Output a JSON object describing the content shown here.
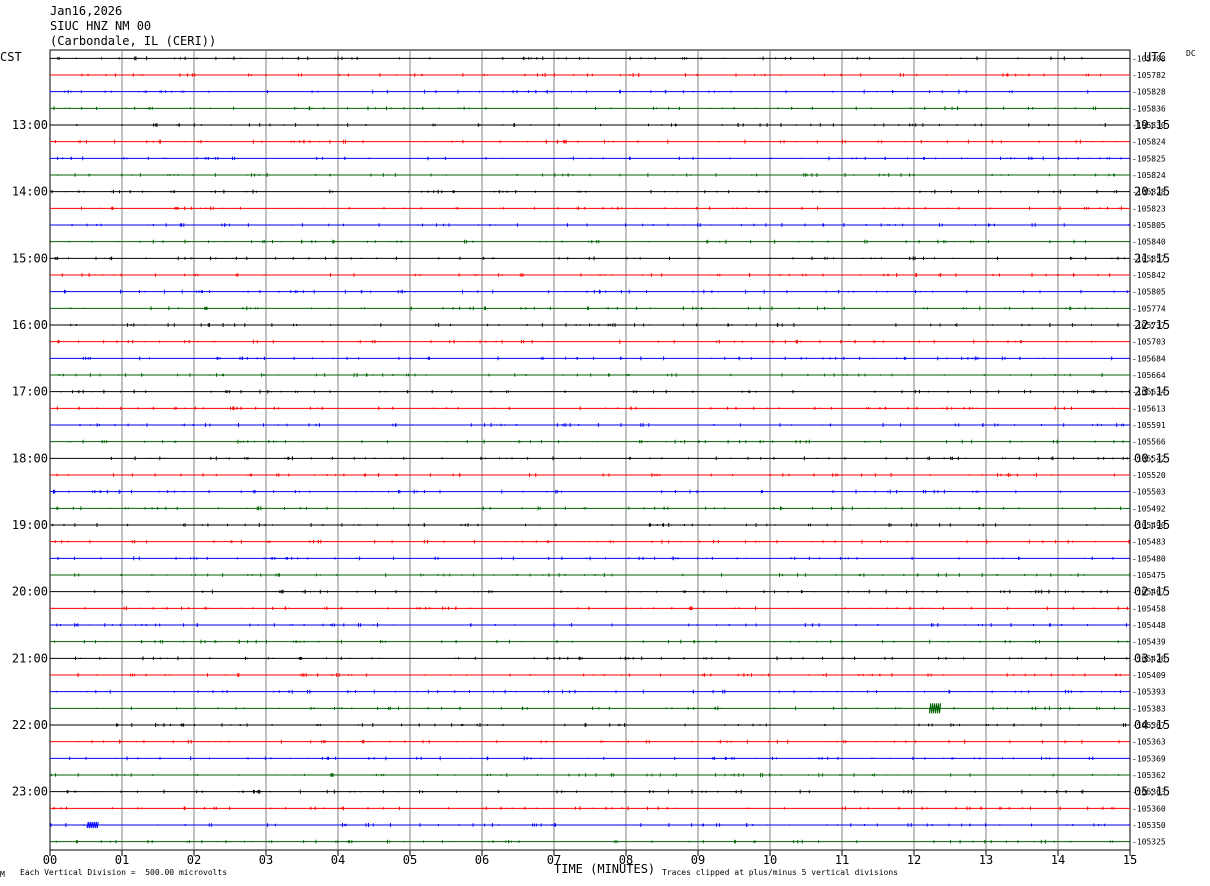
{
  "header": {
    "date": "Jan16,2026",
    "station": "SIUC HNZ NM 00",
    "location": "(Carbondale, IL (CERI))"
  },
  "left_zone_label": "CST",
  "right_zone_label": "UTC",
  "dc_label": "DC",
  "footer": {
    "scale_note": "Each Vertical Division =  500.00 microvolts",
    "clip_note": "Traces clipped at plus/minus 5 vertical divisions",
    "corner_mark": "M"
  },
  "colors": {
    "black": "#000000",
    "red": "#ff0000",
    "blue": "#0000ff",
    "green": "#006400",
    "grid": "#808080"
  },
  "chart_data": {
    "type": "helicorder",
    "xlabel": "TIME (MINUTES)",
    "x_ticks": [
      "00",
      "01",
      "02",
      "03",
      "04",
      "05",
      "06",
      "07",
      "08",
      "09",
      "10",
      "11",
      "12",
      "13",
      "14",
      "15"
    ],
    "xlim": [
      0,
      15
    ],
    "left_time_labels": [
      "13:00",
      "14:00",
      "15:00",
      "16:00",
      "17:00",
      "18:00",
      "19:00",
      "20:00",
      "21:00",
      "22:00",
      "23:00"
    ],
    "right_time_labels": [
      "19:15",
      "20:15",
      "21:15",
      "22:15",
      "23:15",
      "00:15",
      "01:15",
      "02:15",
      "03:15",
      "04:15",
      "05:15"
    ],
    "trace_colors": [
      "black",
      "red",
      "blue",
      "green"
    ],
    "dc_offsets": [
      "-105708",
      "-105782",
      "-105828",
      "-105836",
      "-105830",
      "-105824",
      "-105825",
      "-105824",
      "-105828",
      "-105823",
      "-105805",
      "-105840",
      "-105857",
      "-105842",
      "-105805",
      "-105774",
      "-105737",
      "-105703",
      "-105684",
      "-105664",
      "-105634",
      "-105613",
      "-105591",
      "-105566",
      "-105542",
      "-105520",
      "-105503",
      "-105492",
      "-105490",
      "-105483",
      "-105480",
      "-105475",
      "-105467",
      "-105458",
      "-105448",
      "-105439",
      "-105426",
      "-105409",
      "-105393",
      "-105383",
      "-105367",
      "-105363",
      "-105369",
      "-105362",
      "-105363",
      "-105360",
      "-105350",
      "-105325"
    ],
    "events": [
      {
        "trace": 39,
        "minute": 12.3,
        "type": "spike"
      },
      {
        "trace": 46,
        "minute": 0.6,
        "type": "burst"
      }
    ]
  }
}
